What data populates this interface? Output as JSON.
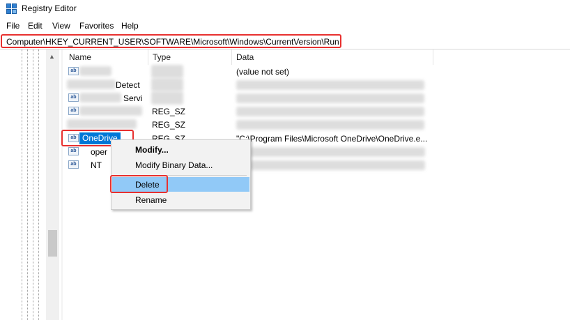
{
  "window": {
    "title": "Registry Editor",
    "icon": "registry-editor-icon"
  },
  "menu": [
    "File",
    "Edit",
    "View",
    "Favorites",
    "Help"
  ],
  "address": {
    "path": "Computer\\HKEY_CURRENT_USER\\SOFTWARE\\Microsoft\\Windows\\CurrentVersion\\Run"
  },
  "columns": {
    "name": "Name",
    "type": "Type",
    "data": "Data"
  },
  "rows": [
    {
      "name": "",
      "type": "",
      "data": "(value not set)"
    },
    {
      "name": "Detect",
      "type": "",
      "data": ""
    },
    {
      "name": "Servi",
      "type": "",
      "data": ""
    },
    {
      "name": "",
      "type": "REG_SZ",
      "data": ""
    },
    {
      "name": "",
      "type": "REG_SZ",
      "data": ""
    },
    {
      "name": "OneDrive",
      "type": "REG_SZ",
      "data": "\"C:\\Program Files\\Microsoft OneDrive\\OneDrive.e..."
    },
    {
      "name": "oper",
      "type": "",
      "data": ""
    },
    {
      "name": "NT",
      "type": "",
      "data": ""
    }
  ],
  "context_menu": {
    "modify": "Modify...",
    "modify_binary": "Modify Binary Data...",
    "delete": "Delete",
    "rename": "Rename"
  },
  "colors": {
    "highlight_border": "#e8302f",
    "selection": "#0078d7",
    "menu_hover": "#91c9f7"
  }
}
